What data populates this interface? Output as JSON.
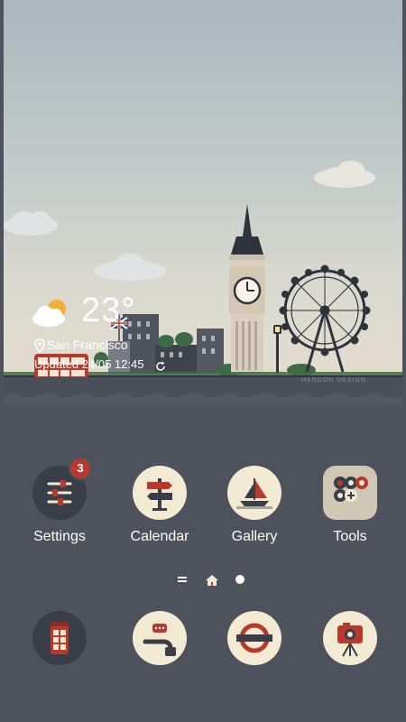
{
  "weather": {
    "temperature": "23°",
    "location": "San Francisco",
    "updated": "Updated 24/05 12:45",
    "condition_icon": "partly-cloudy-icon"
  },
  "scene": {
    "watermark": "HANDON DESIGN"
  },
  "apps": [
    {
      "label": "Settings",
      "icon": "settings-sliders-icon",
      "badge": "3"
    },
    {
      "label": "Calendar",
      "icon": "signpost-icon"
    },
    {
      "label": "Gallery",
      "icon": "sailboat-icon"
    },
    {
      "label": "Tools",
      "icon": "folder-icon"
    }
  ],
  "dock": [
    {
      "icon": "phone-booth-icon"
    },
    {
      "icon": "pipe-chat-icon"
    },
    {
      "icon": "underground-logo-icon"
    },
    {
      "icon": "camera-tripod-icon"
    }
  ],
  "page_indicator": {
    "pages": [
      "menu",
      "home",
      "dot"
    ],
    "current": "home"
  },
  "colors": {
    "background": "#4e525d",
    "accent_red": "#b93a2d",
    "cream": "#f3ead3"
  }
}
